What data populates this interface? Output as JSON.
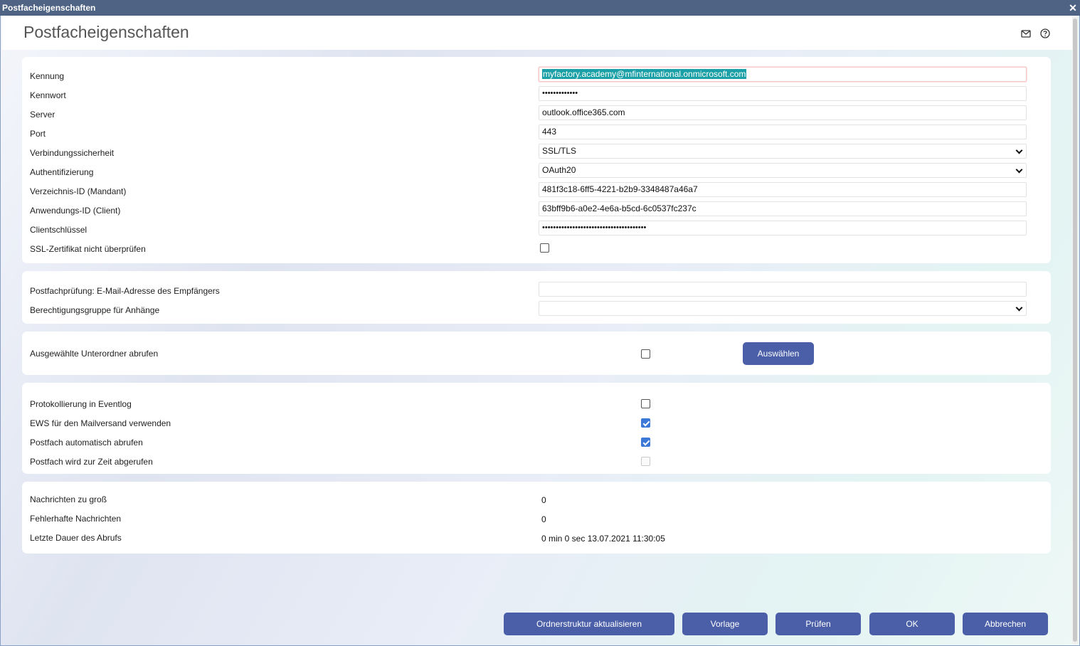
{
  "window": {
    "title": "Postfacheigenschaften",
    "close_glyph": "✕"
  },
  "header": {
    "title": "Postfacheigenschaften",
    "icons": [
      "mail-icon",
      "help-icon"
    ]
  },
  "connection": {
    "kennung": {
      "label": "Kennung",
      "value": "myfactory.academy@mfinternational.onmicrosoft.com"
    },
    "kennwort": {
      "label": "Kennwort",
      "value": "•••••••••••••"
    },
    "server": {
      "label": "Server",
      "value": "outlook.office365.com"
    },
    "port": {
      "label": "Port",
      "value": "443"
    },
    "security": {
      "label": "Verbindungssicherheit",
      "value": "SSL/TLS"
    },
    "auth": {
      "label": "Authentifizierung",
      "value": "OAuth20"
    },
    "tenant": {
      "label": "Verzeichnis-ID (Mandant)",
      "value": "481f3c18-6ff5-4221-b2b9-3348487a46a7"
    },
    "client": {
      "label": "Anwendungs-ID (Client)",
      "value": "63bff9b6-a0e2-4e6a-b5cd-6c0537fc237c"
    },
    "secret": {
      "label": "Clientschlüssel",
      "value": "••••••••••••••••••••••••••••••••••••••"
    },
    "ssl_skip": {
      "label": "SSL-Zertifikat nicht überprüfen",
      "checked": false
    }
  },
  "mailbox_check": {
    "recipient": {
      "label": "Postfachprüfung: E-Mail-Adresse des Empfängers",
      "value": ""
    },
    "attachments_group": {
      "label": "Berechtigungsgruppe für Anhänge",
      "value": ""
    }
  },
  "subfolders": {
    "label": "Ausgewählte Unterordner abrufen",
    "checked": false,
    "button": "Auswählen"
  },
  "options": {
    "eventlog": {
      "label": "Protokollierung in Eventlog",
      "checked": false
    },
    "ews": {
      "label": "EWS für den Mailversand verwenden",
      "checked": true
    },
    "auto": {
      "label": "Postfach automatisch abrufen",
      "checked": true
    },
    "busy": {
      "label": "Postfach wird zur Zeit abgerufen",
      "checked": false,
      "disabled": true
    }
  },
  "stats": {
    "too_large": {
      "label": "Nachrichten zu groß",
      "value": "0"
    },
    "faulty": {
      "label": "Fehlerhafte Nachrichten",
      "value": "0"
    },
    "last_duration": {
      "label": "Letzte Dauer des Abrufs",
      "value": "0 min 0 sec 13.07.2021 11:30:05"
    }
  },
  "footer": {
    "refresh": "Ordnerstruktur aktualisieren",
    "template": "Vorlage",
    "check": "Prüfen",
    "ok": "OK",
    "cancel": "Abbrechen"
  },
  "colors": {
    "titlebar": "#4f6384",
    "button": "#4a5fa8",
    "checkbox_checked": "#3c78d8",
    "selection": "#1aa0a6"
  }
}
